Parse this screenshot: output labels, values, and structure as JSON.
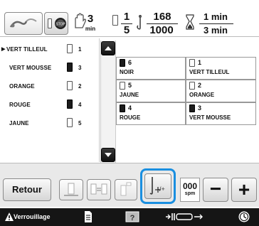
{
  "header": {
    "speed_value": "3",
    "speed_unit": "min",
    "stop_fraction_top": "1",
    "stop_fraction_bottom": "5",
    "stitch_top": "168",
    "stitch_bottom": "1000",
    "time_top": "1 min",
    "time_bottom": "3 min"
  },
  "thread_list": [
    {
      "name": "VERT TILLEUL",
      "num": "1",
      "filled": false,
      "current": true
    },
    {
      "name": "VERT MOUSSE",
      "num": "3",
      "filled": true,
      "current": false
    },
    {
      "name": "ORANGE",
      "num": "2",
      "filled": false,
      "current": false
    },
    {
      "name": "ROUGE",
      "num": "4",
      "filled": true,
      "current": false
    },
    {
      "name": "JAUNE",
      "num": "5",
      "filled": false,
      "current": false
    }
  ],
  "needle_grid": [
    {
      "num": "6",
      "name": "NOIR",
      "filled": true
    },
    {
      "num": "1",
      "name": "VERT TILLEUL",
      "filled": false
    },
    {
      "num": "5",
      "name": "JAUNE",
      "filled": false
    },
    {
      "num": "2",
      "name": "ORANGE",
      "filled": false
    },
    {
      "num": "4",
      "name": "ROUGE",
      "filled": true
    },
    {
      "num": "3",
      "name": "VERT MOUSSE",
      "filled": true
    }
  ],
  "toolbar": {
    "back_label": "Retour",
    "speed_value": "000",
    "speed_unit": "spm",
    "minus_label": "−",
    "plus_label": "+"
  },
  "statusbar": {
    "lock_label": "Verrouillage"
  },
  "colors": {
    "highlight": "#1a8fe0",
    "status_bg": "#151515"
  }
}
